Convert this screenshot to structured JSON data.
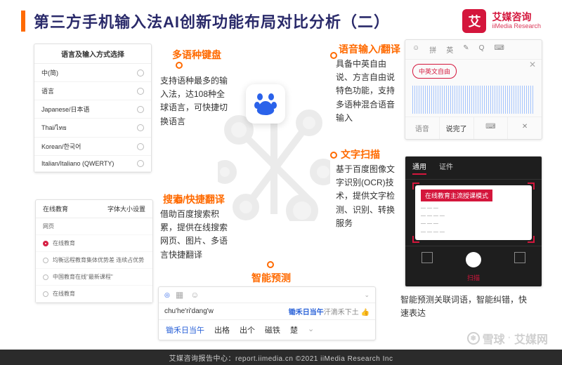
{
  "header": {
    "title": "第三方手机输入法AI创新功能布局对比分析（二）",
    "brand_name": "艾媒咨询",
    "brand_sub": "iiMedia Research",
    "brand_glyph": "艾"
  },
  "features": {
    "multi_lang": {
      "label": "多语种键盘",
      "desc": "支持语种最多的输入法，达108种全球语言，可快捷切换语言"
    },
    "voice": {
      "label": "语音输入/翻译",
      "desc": "具备中英自由说、方言自由说特色功能，支持多语种混合语音输入"
    },
    "ocr": {
      "label": "文字扫描",
      "desc": "基于百度图像文字识别(OCR)技术，提供文字检测、识别、转换服务"
    },
    "search": {
      "label": "搜索/快捷翻译",
      "desc": "借助百度搜索积累，提供在线搜索网页、图片、多语言快捷翻译"
    },
    "predict": {
      "label": "智能预测",
      "desc": "智能预测关联词语，智能纠错，快速表达"
    }
  },
  "lang_panel": {
    "title": "语言及输入方式选择",
    "items": [
      "中(简)",
      "语言",
      "Japanese/日本语",
      "Thai/ไทย",
      "Korean/한국어",
      "Italian/Italiano (QWERTY)"
    ]
  },
  "voice_panel": {
    "tabs": [
      "☺",
      "拼",
      "英",
      "✎",
      "Q",
      "⌨"
    ],
    "pill": "中英文自由",
    "buttons": [
      "语音",
      "说完了",
      "⌨",
      "✕"
    ]
  },
  "ocr_panel": {
    "tabs": [
      "通用",
      "证件"
    ],
    "card_title": "在线教育主流授课模式",
    "bottom_labels": [
      "",
      "扫描",
      ""
    ]
  },
  "settings_panel": {
    "left": "在线教育",
    "right": "字体大小设置",
    "col": "网页",
    "rows": [
      "在线教育",
      "均衡远程教育集体优势差 连续占优势",
      "中国教育在线\"最新课程\"",
      "在线教育"
    ]
  },
  "ime": {
    "input": "chu'he'ri'dang'w",
    "suggestion_prefix": "锄禾日当午",
    "suggestion_rest": "汗滴禾下土",
    "candidates": [
      "锄禾日当午",
      "出格",
      "出个",
      "磁铁",
      "楚"
    ]
  },
  "footer": {
    "text": "艾媒咨询报告中心：report.iimedia.cn    ©2021  iiMedia Research  Inc"
  },
  "watermark": {
    "left": "雪球",
    "right": "艾媒网"
  }
}
